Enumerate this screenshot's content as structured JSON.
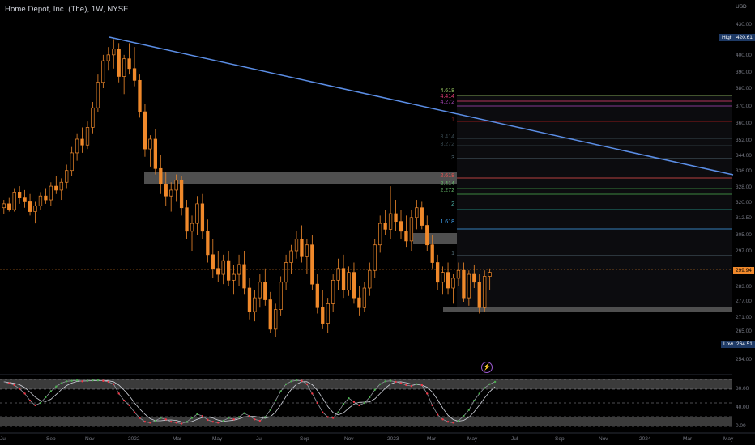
{
  "header": {
    "title": "Home Depot, Inc. (The), 1W, NYSE",
    "currency": "USD"
  },
  "price_axis": {
    "ticks": [
      "430.00",
      "410.00",
      "400.00",
      "390.00",
      "380.00",
      "370.00",
      "360.00",
      "352.00",
      "344.00",
      "336.00",
      "328.00",
      "320.00",
      "312.50",
      "305.00",
      "297.00",
      "289.00",
      "283.00",
      "277.00",
      "271.00",
      "265.00",
      "259.50",
      "254.00"
    ],
    "high_label": "High",
    "high_value": "420.61",
    "low_label": "Low",
    "low_value": "264.51",
    "current_value": "299.94"
  },
  "time_axis": {
    "labels": [
      "Jul",
      "Sep",
      "Nov",
      "2022",
      "Mar",
      "May",
      "Jul",
      "Sep",
      "Nov",
      "2023",
      "Mar",
      "May",
      "Jul",
      "Sep",
      "Nov",
      "2024",
      "Mar",
      "May"
    ]
  },
  "fib_labels": [
    "4.618",
    "4.414",
    "4.272",
    "1",
    "3.414",
    "3.272",
    "3",
    "2.618",
    "2.414",
    "2.272",
    "2",
    "1.618",
    "1"
  ],
  "oscillator": {
    "levels": [
      "80.00",
      "40.00",
      "0.00"
    ]
  },
  "colors": {
    "background": "#000000",
    "candle": "#f0892b",
    "trendline": "#5b8ee6",
    "osc_line": "#d1d4dc",
    "osc_up": "#4caf50",
    "osc_down": "#f23645"
  },
  "icons": {
    "alert": "lightning-icon"
  }
}
